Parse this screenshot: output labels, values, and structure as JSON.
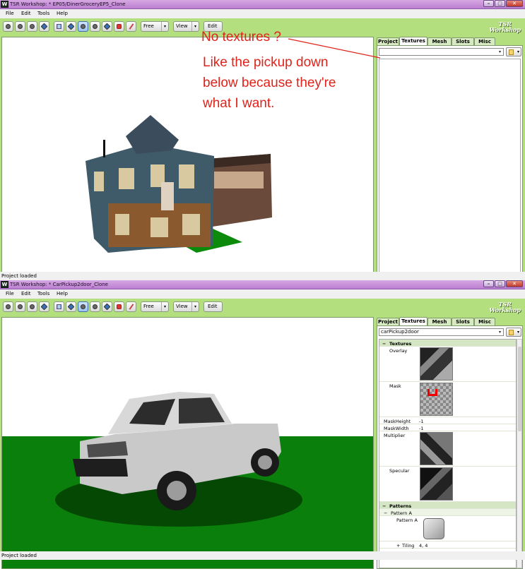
{
  "window1": {
    "title": "TSR Workshop: * EP05/DinerGroceryEP5_Clone",
    "menu": [
      "File",
      "Edit",
      "Tools",
      "Help"
    ],
    "toolbar": {
      "free_label": "Free",
      "view_label": "View",
      "edit_label": "Edit"
    },
    "logo": {
      "line1": "TSR",
      "line2": "Workshop"
    },
    "tabs": [
      "Project",
      "Textures",
      "Mesh",
      "Slots",
      "Misc"
    ],
    "active_tab": "Textures",
    "selector_value": "",
    "status": "Project loaded"
  },
  "annotation": {
    "line1": "No textures ?",
    "line2": "Like the pickup down",
    "line3": "below because they're",
    "line4": "what I want.",
    "color": "#e0231a"
  },
  "window2": {
    "title": "TSR Workshop: * CarPickup2door_Clone",
    "menu": [
      "File",
      "Edit",
      "Tools",
      "Help"
    ],
    "toolbar": {
      "free_label": "Free",
      "view_label": "View",
      "edit_label": "Edit"
    },
    "logo": {
      "line1": "TSR",
      "line2": "Workshop"
    },
    "tabs": [
      "Project",
      "Textures",
      "Mesh",
      "Slots",
      "Misc"
    ],
    "active_tab": "Textures",
    "selector_value": "carPickup2door",
    "properties": {
      "textures_header": "Textures",
      "overlay_label": "Overlay",
      "mask_label": "Mask",
      "maskheight_label": "MaskHeight",
      "maskheight_value": "-1",
      "maskwidth_label": "MaskWidth",
      "maskwidth_value": "-1",
      "multiplier_label": "Multiplier",
      "specular_label": "Specular",
      "patterns_header": "Patterns",
      "pattern_group": "Pattern A",
      "pattern_label": "Pattern A",
      "tiling_label": "Tiling",
      "tiling_value": "4, 4"
    },
    "status": "Project loaded"
  },
  "colors": {
    "chrome": "#b3df7f",
    "titlebar": "#c792d9",
    "annotation": "#e0231a"
  }
}
